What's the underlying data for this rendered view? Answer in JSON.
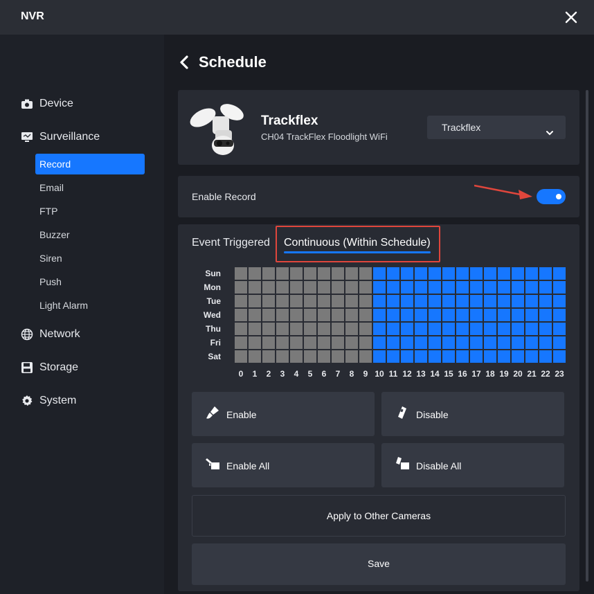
{
  "window": {
    "title": "NVR"
  },
  "sidebar": {
    "device": "Device",
    "surveillance": "Surveillance",
    "sub_items": [
      "Record",
      "Email",
      "FTP",
      "Buzzer",
      "Siren",
      "Push",
      "Light Alarm"
    ],
    "network": "Network",
    "storage": "Storage",
    "system": "System"
  },
  "page": {
    "title": "Schedule"
  },
  "camera": {
    "name": "Trackflex",
    "model": "CH04 TrackFlex Floodlight WiFi",
    "selected": "Trackflex"
  },
  "record": {
    "label": "Enable Record",
    "enabled": true
  },
  "tabs": {
    "event": "Event Triggered",
    "continuous": "Continuous (Within Schedule)",
    "active": "continuous"
  },
  "schedule": {
    "days": [
      "Sun",
      "Mon",
      "Tue",
      "Wed",
      "Thu",
      "Fri",
      "Sat"
    ],
    "hours": [
      "0",
      "1",
      "2",
      "3",
      "4",
      "5",
      "6",
      "7",
      "8",
      "9",
      "10",
      "11",
      "12",
      "13",
      "14",
      "15",
      "16",
      "17",
      "18",
      "19",
      "20",
      "21",
      "22",
      "23"
    ],
    "enabled_from_hour": 10,
    "enabled_to_hour": 23
  },
  "buttons": {
    "enable": "Enable",
    "disable": "Disable",
    "enable_all": "Enable All",
    "disable_all": "Disable All",
    "apply": "Apply to Other Cameras",
    "save": "Save"
  },
  "colors": {
    "accent": "#1677ff",
    "cell_off": "#7a7a7a",
    "highlight": "#e0463c"
  }
}
